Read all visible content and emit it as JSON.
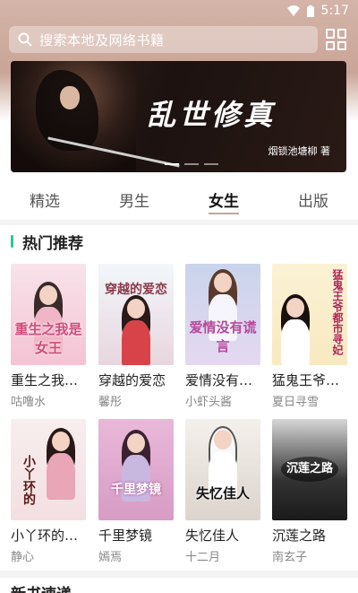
{
  "status": {
    "time": "5:17"
  },
  "search": {
    "placeholder": "搜索本地及网络书籍"
  },
  "banner": {
    "title": "乱世修真",
    "subtitle": "烟锁池塘柳 著"
  },
  "tabs": [
    {
      "label": "精选"
    },
    {
      "label": "男生"
    },
    {
      "label": "女生",
      "active": true
    },
    {
      "label": "出版"
    }
  ],
  "section": {
    "title": "热门推荐"
  },
  "books": [
    {
      "title": "重生之我…",
      "author": "咕噜水",
      "cover_text": "重生之我是女王"
    },
    {
      "title": "穿越的爱恋",
      "author": "馨彤",
      "cover_text": "穿越的爱恋"
    },
    {
      "title": "爱情没有…",
      "author": "小虾头酱",
      "cover_text": "爱情没有谎言"
    },
    {
      "title": "猛鬼王爷…",
      "author": "夏日寻雪",
      "cover_text": "猛鬼王爷都市寻妃"
    },
    {
      "title": "小丫环的…",
      "author": "静心",
      "cover_text": "小丫环的"
    },
    {
      "title": "千里梦镜",
      "author": "嫣焉",
      "cover_text": "千里梦镜"
    },
    {
      "title": "失忆佳人",
      "author": "十二月",
      "cover_text": "失忆佳人"
    },
    {
      "title": "沉莲之路",
      "author": "南玄子",
      "cover_text": "沉莲之路"
    }
  ],
  "next_section": {
    "title": "新书速递"
  },
  "colors": {
    "accent": "#c9a597",
    "section_bar": "#34c38f"
  }
}
